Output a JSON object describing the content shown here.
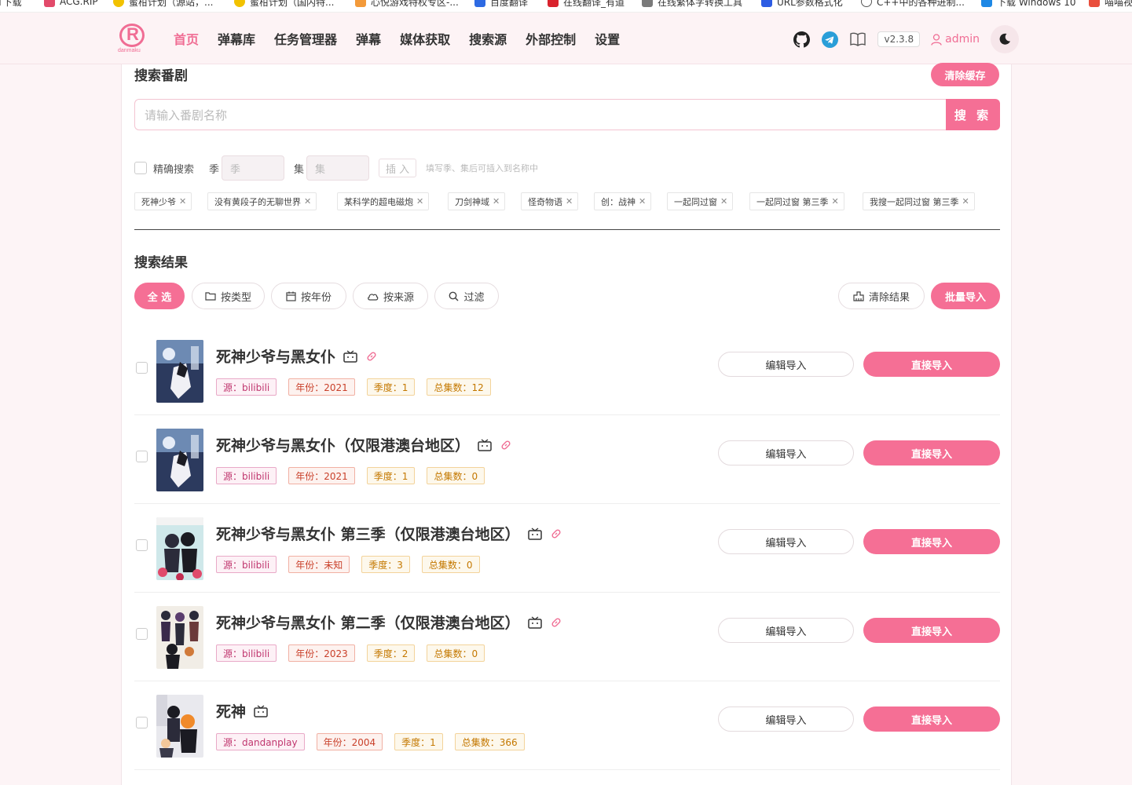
{
  "bookmarks": [
    {
      "label": "BT下载",
      "color": "#3a7bd5"
    },
    {
      "label": "ACG.RIP",
      "color": "#e24a6a"
    },
    {
      "label": "蜜柑计划（源站，...",
      "color": "#f2c200"
    },
    {
      "label": "蜜柑计划（国内特...",
      "color": "#f2c200"
    },
    {
      "label": "心悦游戏特权专区-...",
      "color": "#f39a3a"
    },
    {
      "label": "百度翻译",
      "color": "#2d6ae3"
    },
    {
      "label": "在线翻译_有道",
      "color": "#d9232d"
    },
    {
      "label": "在线繁体字转换工具",
      "color": "#7a7a7a"
    },
    {
      "label": "URL参数格式化",
      "color": "#2d5ce3"
    },
    {
      "label": "C++中的各种进制...",
      "color": "#555555"
    },
    {
      "label": "下载 Windows 10",
      "color": "#1e88e5"
    },
    {
      "label": "喵喵视",
      "color": "#e94e3c"
    }
  ],
  "header": {
    "logo_text": "R",
    "logo_sub": "danmaku",
    "nav": [
      "首页",
      "弹幕库",
      "任务管理器",
      "弹幕",
      "媒体获取",
      "搜索源",
      "外部控制",
      "设置"
    ],
    "active_nav": "首页",
    "version": "v2.3.8",
    "user": "admin",
    "accent": "#f06d94"
  },
  "search": {
    "title": "搜索番剧",
    "clear_cache": "清除缓存",
    "placeholder": "请输入番剧名称",
    "button": "搜 索",
    "exact_label": "精确搜索",
    "season_label": "季",
    "season_placeholder": "季",
    "episode_label": "集",
    "episode_placeholder": "集",
    "insert_button": "插 入",
    "hint": "填写季、集后可插入到名称中",
    "history": [
      "死神少爷",
      "没有黄段子的无聊世界",
      "某科学的超电磁炮",
      "刀剑神域",
      "怪奇物语",
      "创：战神",
      "一起同过窗",
      "一起同过窗 第三季",
      "我搜一起同过窗 第三季"
    ]
  },
  "results": {
    "title": "搜索结果",
    "select_all": "全 选",
    "by_type": "按类型",
    "by_year": "按年份",
    "by_source": "按来源",
    "filter": "过滤",
    "clear_results": "清除结果",
    "batch_import": "批量导入",
    "edit_import": "编辑导入",
    "direct_import": "直接导入",
    "items": [
      {
        "title": "死神少爷与黑女仆",
        "source": "源：bilibili",
        "year": "年份：2021",
        "season": "季度：1",
        "episodes": "总集数：12",
        "link": true
      },
      {
        "title": "死神少爷与黑女仆（仅限港澳台地区）",
        "source": "源：bilibili",
        "year": "年份：2021",
        "season": "季度：1",
        "episodes": "总集数：0",
        "link": true
      },
      {
        "title": "死神少爷与黑女仆 第三季（仅限港澳台地区）",
        "source": "源：bilibili",
        "year": "年份：未知",
        "season": "季度：3",
        "episodes": "总集数：0",
        "link": true
      },
      {
        "title": "死神少爷与黑女仆 第二季（仅限港澳台地区）",
        "source": "源：bilibili",
        "year": "年份：2023",
        "season": "季度：2",
        "episodes": "总集数：0",
        "link": true
      },
      {
        "title": "死神",
        "source": "源：dandanplay",
        "year": "年份：2004",
        "season": "季度：1",
        "episodes": "总集数：366",
        "link": false
      }
    ]
  }
}
